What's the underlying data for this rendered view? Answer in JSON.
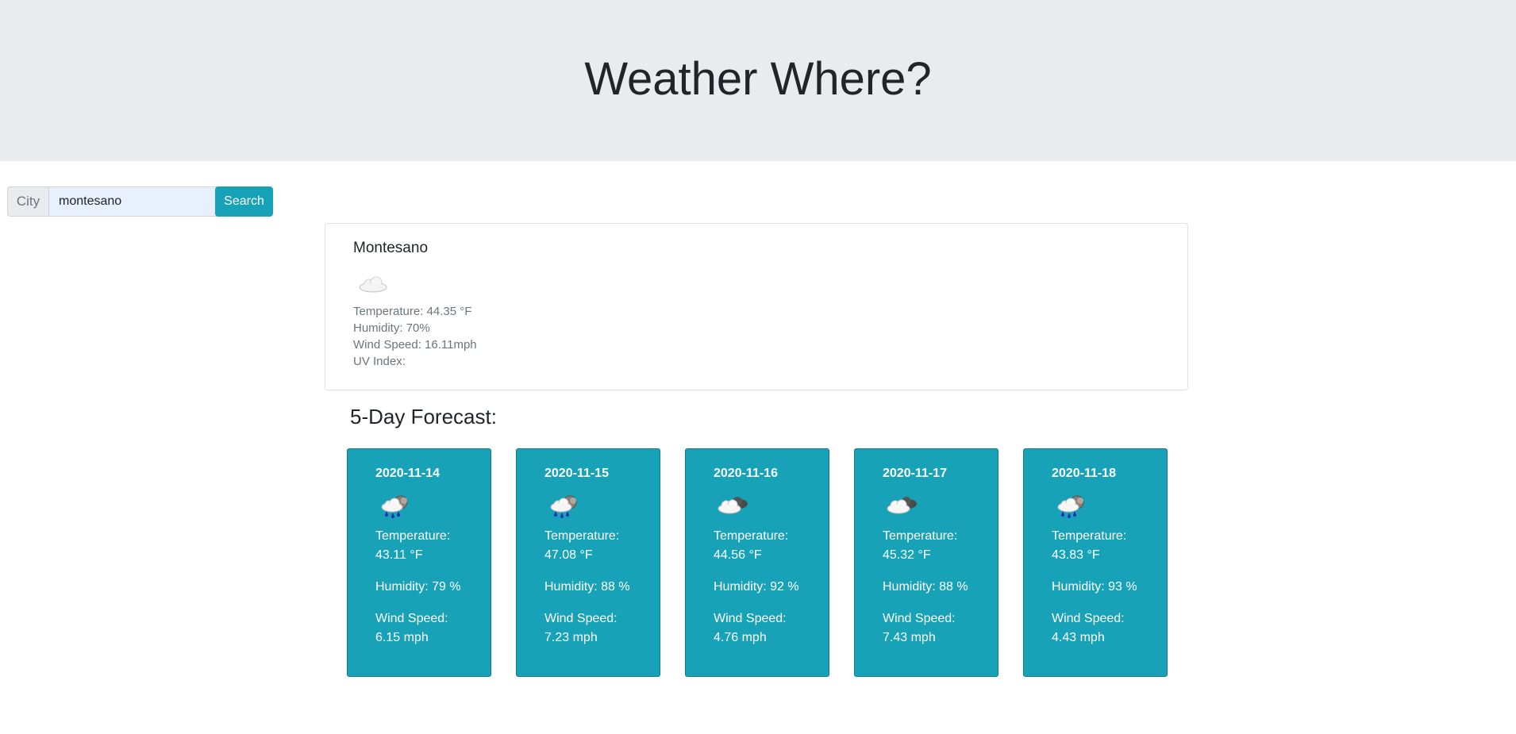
{
  "header": {
    "title": "Weather Where?"
  },
  "search": {
    "prepend_label": "City",
    "value": "montesano",
    "button_label": "Search"
  },
  "current": {
    "city": "Montesano",
    "icon": "cloud-icon",
    "temperature": "Temperature: 44.35 °F",
    "humidity": "Humidity: 70%",
    "wind": "Wind Speed: 16.11mph",
    "uv": "UV Index:"
  },
  "forecast": {
    "title": "5-Day Forecast:",
    "days": [
      {
        "date": "2020-11-14",
        "icon": "rain-cloud-icon",
        "temp_label": "Temperature:",
        "temp": "43.11 °F",
        "humidity": "Humidity: 79 %",
        "wind_label": "Wind Speed:",
        "wind": "6.15 mph"
      },
      {
        "date": "2020-11-15",
        "icon": "rain-cloud-icon",
        "temp_label": "Temperature:",
        "temp": "47.08 °F",
        "humidity": "Humidity: 88 %",
        "wind_label": "Wind Speed:",
        "wind": "7.23 mph"
      },
      {
        "date": "2020-11-16",
        "icon": "broken-clouds-icon",
        "temp_label": "Temperature:",
        "temp": "44.56 °F",
        "humidity": "Humidity: 92 %",
        "wind_label": "Wind Speed:",
        "wind": "4.76 mph"
      },
      {
        "date": "2020-11-17",
        "icon": "broken-clouds-icon",
        "temp_label": "Temperature:",
        "temp": "45.32 °F",
        "humidity": "Humidity: 88 %",
        "wind_label": "Wind Speed:",
        "wind": "7.43 mph"
      },
      {
        "date": "2020-11-18",
        "icon": "rain-cloud-icon",
        "temp_label": "Temperature:",
        "temp": "43.83 °F",
        "humidity": "Humidity: 93 %",
        "wind_label": "Wind Speed:",
        "wind": "4.43 mph"
      }
    ]
  },
  "colors": {
    "accent": "#17a2b8",
    "jumbotron": "#e9ecef",
    "input_bg": "#e8f0fe"
  }
}
